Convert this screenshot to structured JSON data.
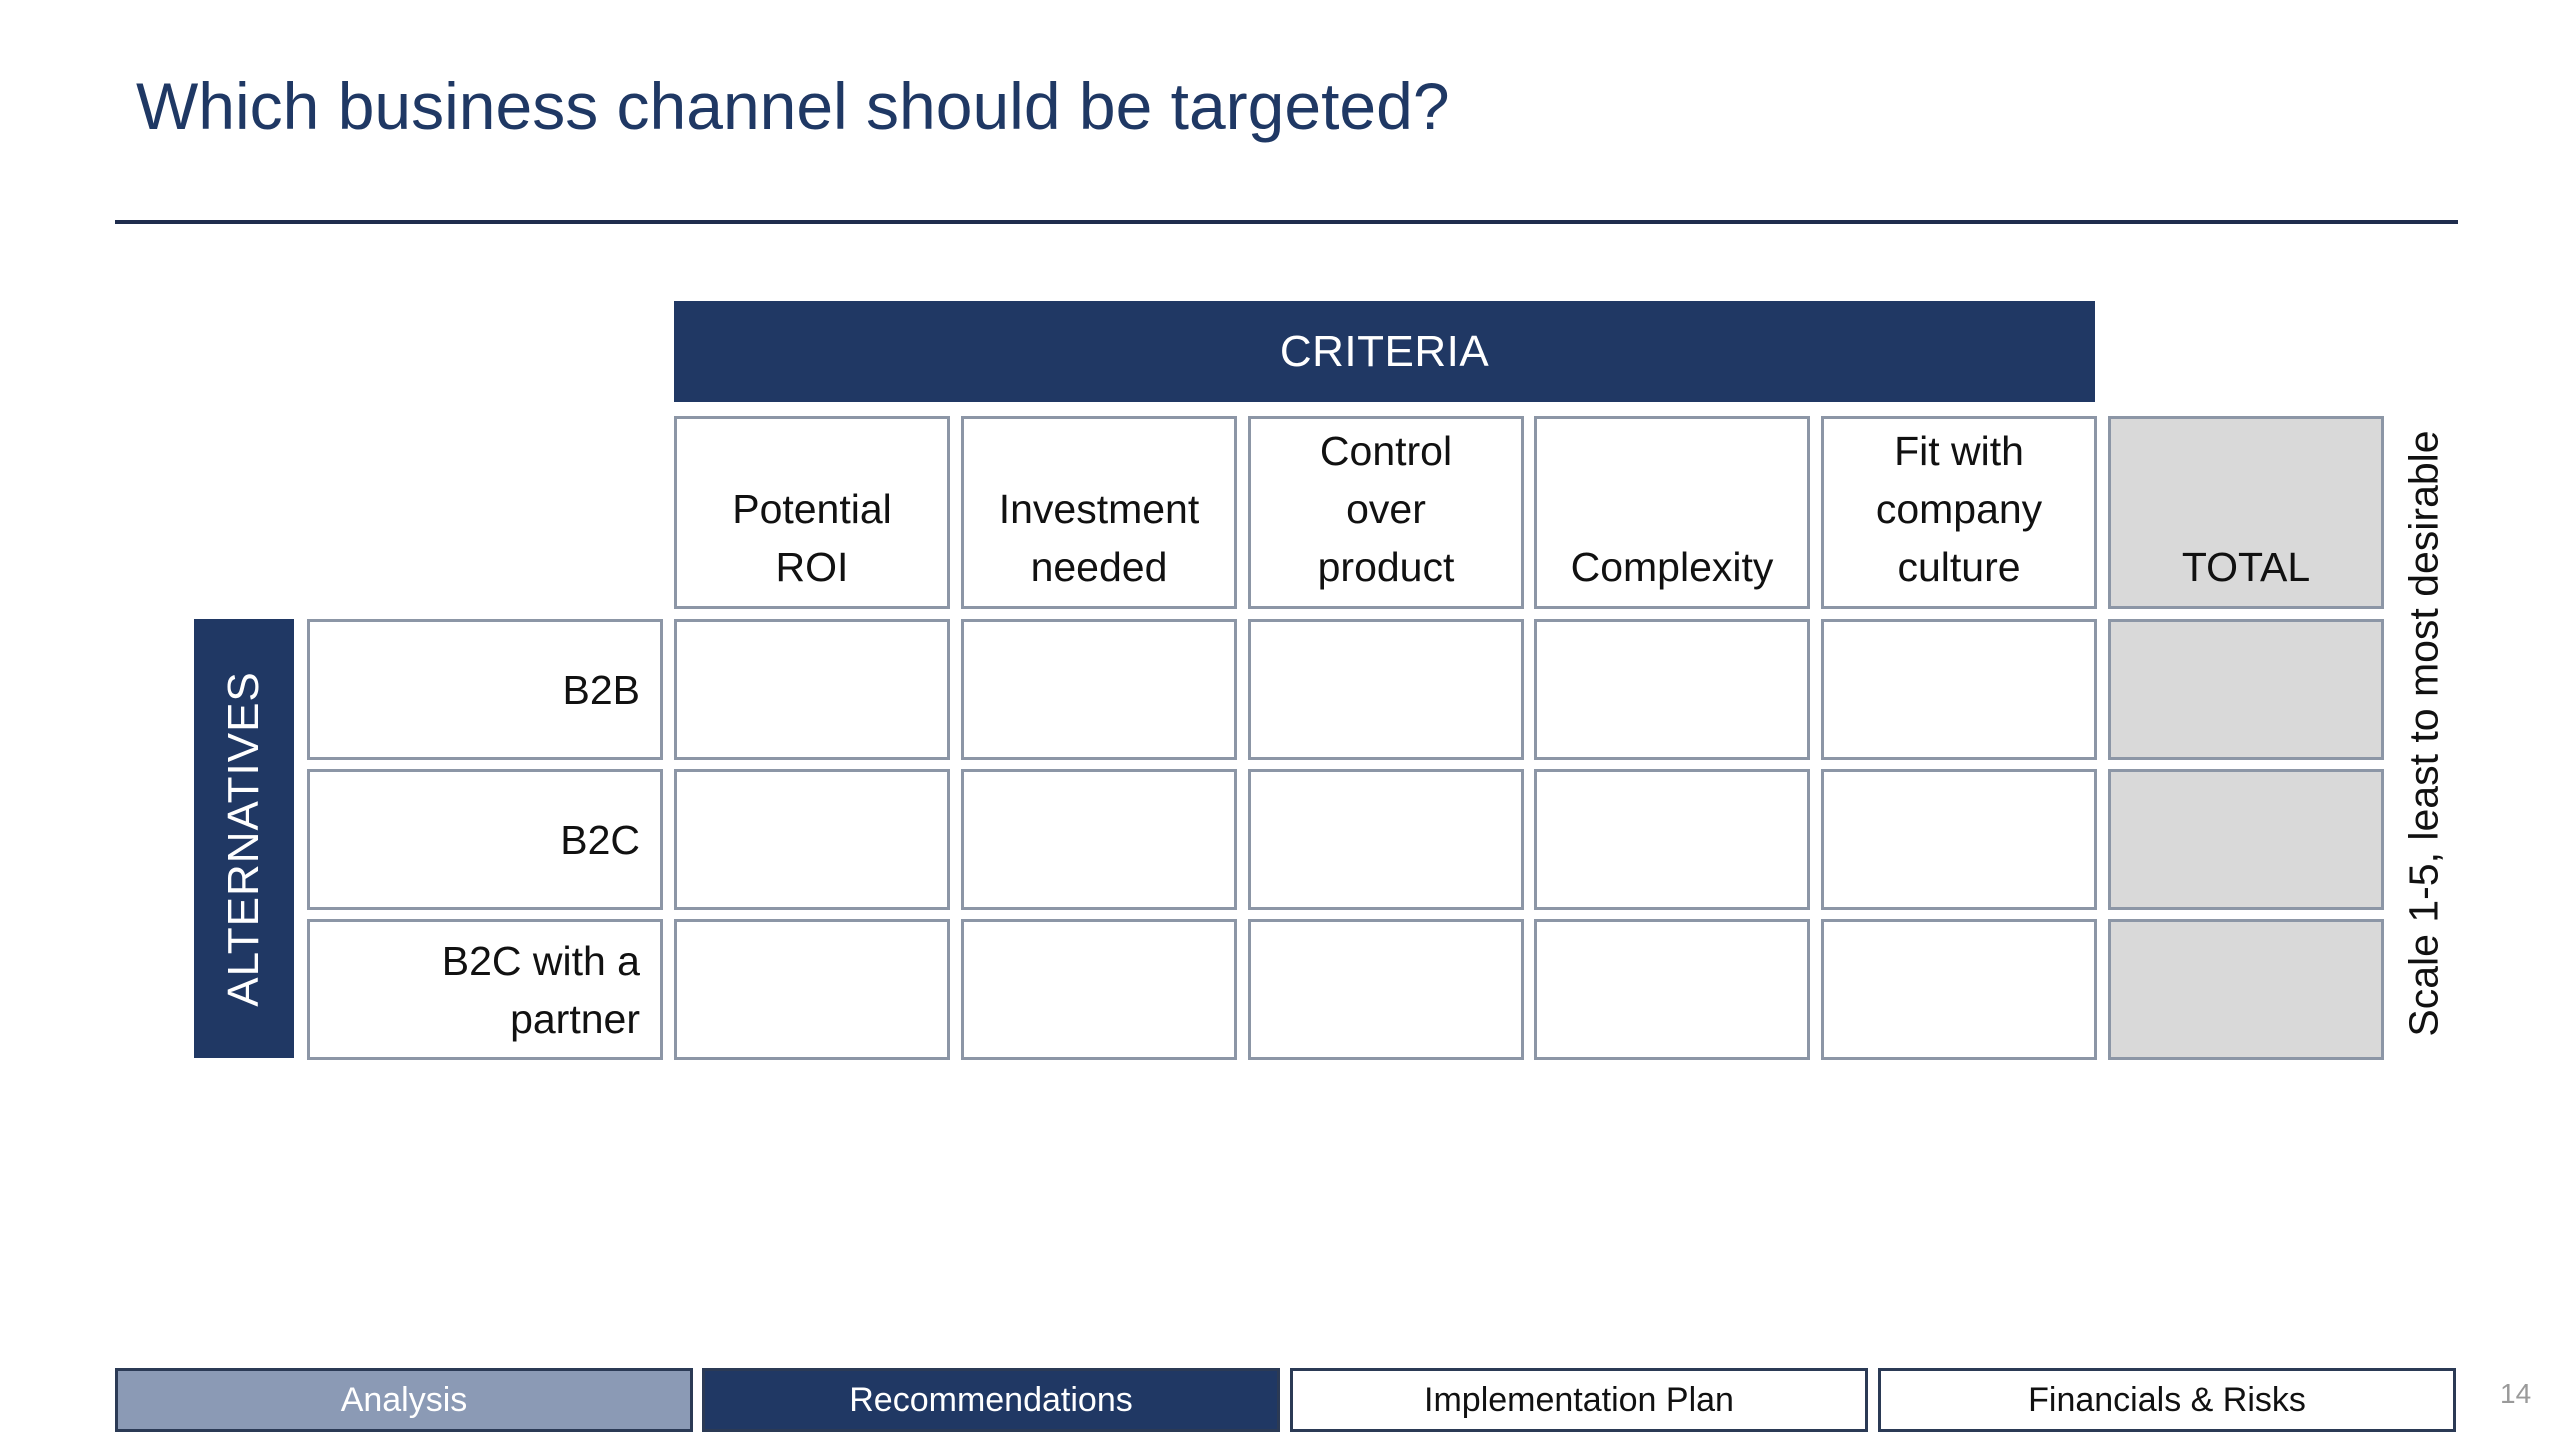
{
  "slide": {
    "title": "Which business channel should be targeted?",
    "page_number": "14"
  },
  "matrix": {
    "criteria_header": "CRITERIA",
    "alternatives_header": "ALTERNATIVES",
    "scale_note": "Scale 1-5, least to most desirable",
    "criteria": [
      {
        "label": "Potential ROI"
      },
      {
        "label": "Investment needed"
      },
      {
        "label": "Control over product"
      },
      {
        "label": "Complexity"
      },
      {
        "label": "Fit with company culture"
      },
      {
        "label": "TOTAL"
      }
    ],
    "alternatives": [
      {
        "label": "B2B"
      },
      {
        "label": "B2C"
      },
      {
        "label": "B2C with a partner"
      }
    ]
  },
  "nav": {
    "tabs": [
      {
        "label": "Analysis"
      },
      {
        "label": "Recommendations"
      },
      {
        "label": "Implementation Plan"
      },
      {
        "label": "Financials & Risks"
      }
    ],
    "active_tab": "Recommendations"
  },
  "colors": {
    "primary_navy": "#203864",
    "title_text": "#1f3864",
    "inactive_tab": "#8b9ab5",
    "total_fill": "#d9d9d9"
  }
}
